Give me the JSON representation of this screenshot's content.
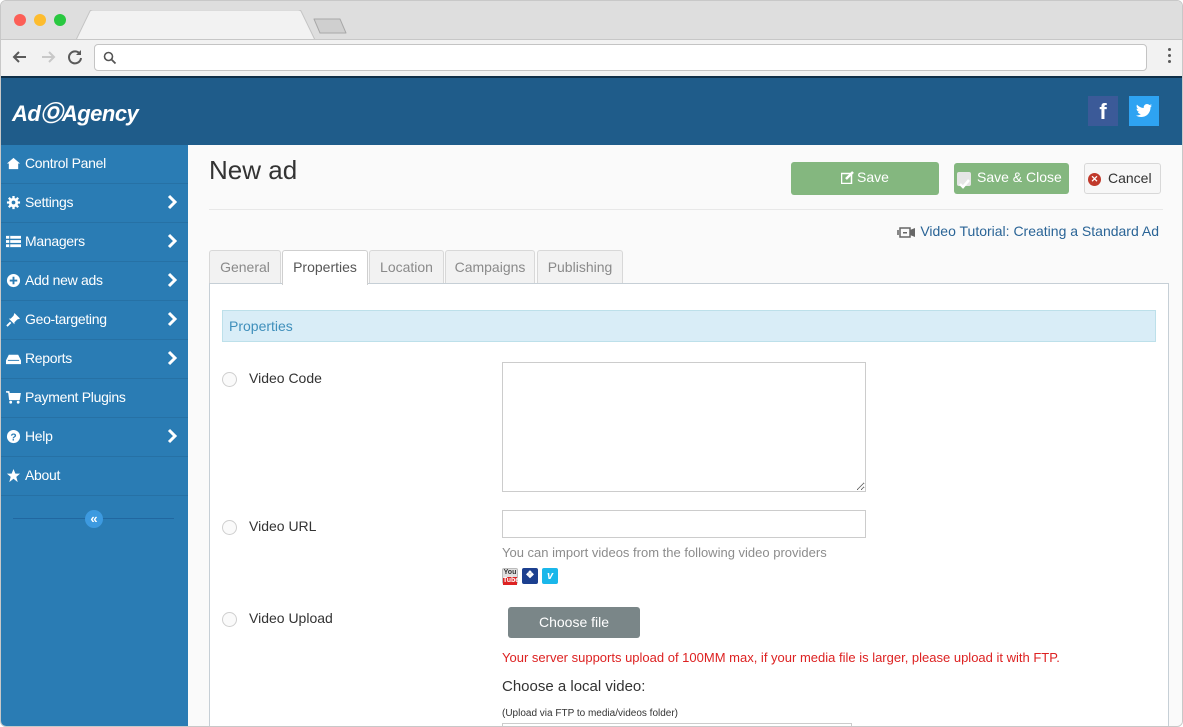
{
  "browser": {
    "address_value": "",
    "address_placeholder": ""
  },
  "header": {
    "logo": "AdⓄAgency",
    "social": [
      {
        "name": "facebook",
        "label": "f",
        "color": "#3b5a98"
      },
      {
        "name": "twitter",
        "color": "#2ea3f2"
      }
    ],
    "colors": {
      "header_bg": "#1f5c8a",
      "sidebar_bg": "#2a7cb4"
    }
  },
  "sidebar": {
    "items": [
      {
        "label": "Control Panel",
        "icon": "home-icon",
        "has_submenu": false
      },
      {
        "label": "Settings",
        "icon": "gear-icon",
        "has_submenu": true
      },
      {
        "label": "Managers",
        "icon": "list-icon",
        "has_submenu": true
      },
      {
        "label": "Add new ads",
        "icon": "plus-circle-icon",
        "has_submenu": true
      },
      {
        "label": "Geo-targeting",
        "icon": "pin-icon",
        "has_submenu": true
      },
      {
        "label": "Reports",
        "icon": "inbox-icon",
        "has_submenu": true
      },
      {
        "label": "Payment Plugins",
        "icon": "cart-icon",
        "has_submenu": false
      },
      {
        "label": "Help",
        "icon": "question-circle-icon",
        "has_submenu": true
      },
      {
        "label": "About",
        "icon": "star-icon",
        "has_submenu": false
      }
    ],
    "collapse_label": "«"
  },
  "main": {
    "title": "New ad",
    "buttons": {
      "save": "Save",
      "save_close": "Save & Close",
      "cancel": "Cancel"
    },
    "button_colors": {
      "save": "#84b77f",
      "cancel_icon": "#c0392b"
    },
    "tutorial_link": "Video Tutorial: Creating a Standard Ad",
    "tabs": [
      {
        "label": "General",
        "active": false
      },
      {
        "label": "Properties",
        "active": true
      },
      {
        "label": "Location",
        "active": false
      },
      {
        "label": "Campaigns",
        "active": false
      },
      {
        "label": "Publishing",
        "active": false
      }
    ],
    "section_title": "Properties",
    "options": {
      "video_code": {
        "label": "Video Code",
        "value": ""
      },
      "video_url": {
        "label": "Video URL",
        "value": "",
        "hint": "You can import videos from the following video providers"
      },
      "video_upload": {
        "label": "Video Upload"
      }
    },
    "providers": [
      {
        "name": "youtube",
        "top": "You",
        "bottom": "Tube"
      },
      {
        "name": "myspace",
        "label": "❖"
      },
      {
        "name": "vimeo",
        "label": "v"
      }
    ],
    "choose_file": "Choose file",
    "upload_warning": "Your server supports upload of 100MM max, if your media file is larger, please upload it with FTP.",
    "warning_color": "#dd2222",
    "local_video_label": "Choose a local video:",
    "ftp_note": "(Upload via FTP to media/videos folder)"
  }
}
